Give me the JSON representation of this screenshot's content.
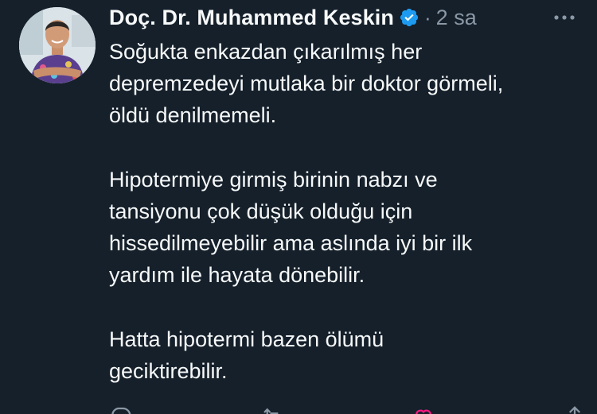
{
  "tweet": {
    "author": {
      "name": "Doç. Dr. Muhammed Keskin",
      "verified": true,
      "avatar_icon": "profile-photo"
    },
    "separator": "·",
    "timestamp": "2 sa",
    "more_icon": "more-horizontal-icon",
    "paragraphs": [
      [
        "Soğukta enkazdan çıkarılmış her",
        "depremzedeyi mutlaka bir doktor görmeli,",
        "öldü denilmemeli."
      ],
      [
        "Hipotermiye girmiş birinin nabzı ve",
        "tansiyonu çok düşük olduğu için",
        "hissedilmeyebilir ama aslında iyi bir ilk",
        "yardım ile hayata dönebilir."
      ],
      [
        "Hatta hipotermi bazen ölümü",
        "geciktirebilir."
      ]
    ],
    "actions": [
      "reply-icon",
      "retweet-icon",
      "like-icon",
      "share-icon"
    ]
  },
  "colors": {
    "background": "#15202b",
    "text_primary": "#f7f9f9",
    "text_secondary": "#8b98a5",
    "verified_badge": "#1d9bf0",
    "like_accent": "#f91880"
  }
}
